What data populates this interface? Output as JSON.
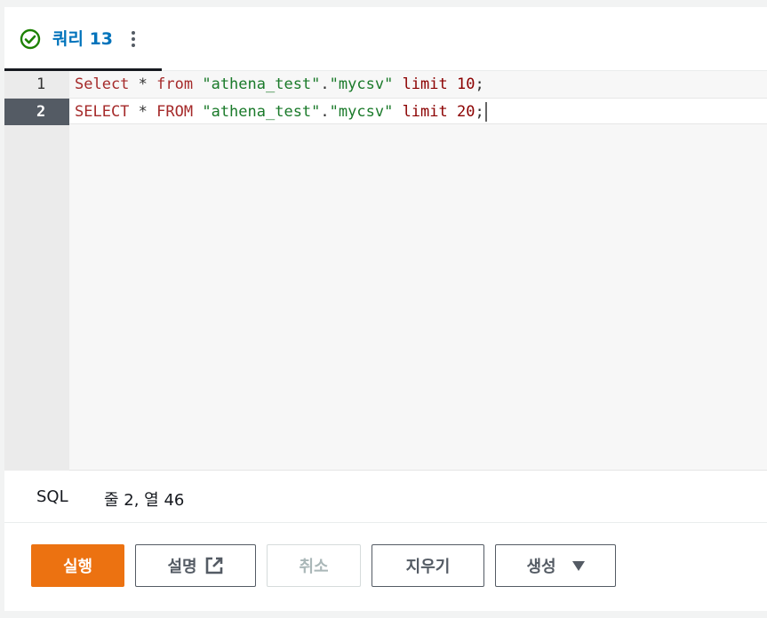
{
  "tab": {
    "label": "쿼리 13",
    "status_icon": "check-circle-icon",
    "status_color": "#1d8102",
    "menu_icon": "more-vertical-icon"
  },
  "editor": {
    "lines": [
      {
        "number": "1",
        "tokens": [
          "Select",
          " * ",
          "from",
          " ",
          "\"athena_test\"",
          ".",
          "\"mycsv\"",
          " ",
          "limit",
          " ",
          "10",
          ";"
        ]
      },
      {
        "number": "2",
        "tokens": [
          "SELECT",
          " * ",
          "FROM",
          " ",
          "\"athena_test\"",
          ".",
          "\"mycsv\"",
          " ",
          "limit",
          " ",
          "20",
          ";"
        ]
      }
    ],
    "active_line": 2
  },
  "status": {
    "language": "SQL",
    "cursor_position": "줄 2, 열 46"
  },
  "buttons": {
    "run": "실행",
    "explain": "설명",
    "cancel": "취소",
    "clear": "지우기",
    "create": "생성"
  },
  "colors": {
    "accent": "#ec7211",
    "tab_text": "#0073bb"
  }
}
